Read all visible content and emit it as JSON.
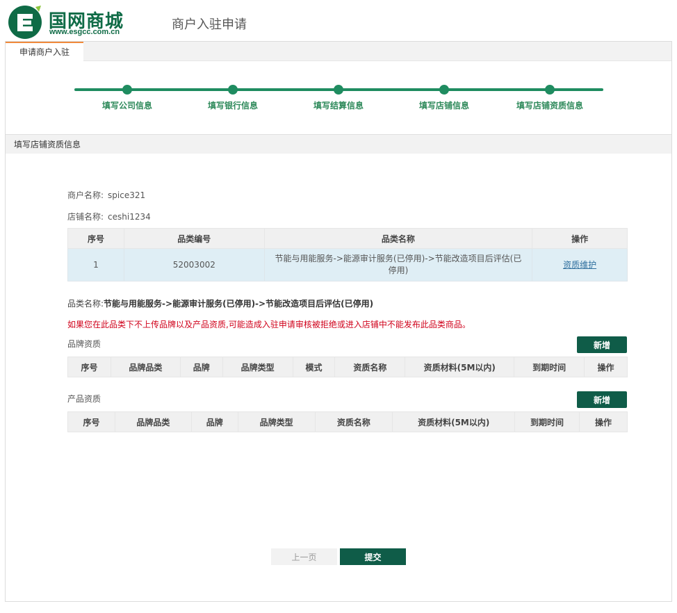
{
  "brand": {
    "name": "国网商城",
    "url": "www.esgcc.com.cn",
    "logo_color": "#0f6b46"
  },
  "header": {
    "title": "商户入驻申请"
  },
  "tabs": {
    "active": "申请商户入驻"
  },
  "steps": [
    {
      "label": "填写公司信息"
    },
    {
      "label": "填写银行信息"
    },
    {
      "label": "填写结算信息"
    },
    {
      "label": "填写店铺信息"
    },
    {
      "label": "填写店铺资质信息"
    }
  ],
  "section": {
    "title": "填写店铺资质信息"
  },
  "merchant": {
    "name_label": "商户名称:",
    "name_value": "spice321",
    "store_label": "店铺名称:",
    "store_value": "ceshi1234"
  },
  "category_table": {
    "headers": [
      "序号",
      "品类编号",
      "品类名称",
      "操作"
    ],
    "rows": [
      {
        "index": "1",
        "code": "52003002",
        "name": "节能与用能服务->能源审计服务(已停用)->节能改造项目后评估(已停用)",
        "action": "资质维护"
      }
    ]
  },
  "category_detail": {
    "label": "品类名称:",
    "value": "节能与用能服务->能源审计服务(已停用)->节能改造项目后评估(已停用)"
  },
  "warning": "如果您在此品类下不上传品牌以及产品资质,可能造成入驻申请审核被拒绝或进入店铺中不能发布此品类商品。",
  "brand_qual": {
    "title": "品牌资质",
    "add_label": "新增",
    "headers": [
      "序号",
      "品牌品类",
      "品牌",
      "品牌类型",
      "模式",
      "资质名称",
      "资质材料(5M以内)",
      "到期时间",
      "操作"
    ]
  },
  "product_qual": {
    "title": "产品资质",
    "add_label": "新增",
    "headers": [
      "序号",
      "品牌品类",
      "品牌",
      "品牌类型",
      "资质名称",
      "资质材料(5M以内)",
      "到期时间",
      "操作"
    ]
  },
  "footer": {
    "prev_label": "上一页",
    "submit_label": "提交"
  },
  "colors": {
    "primary": "#0f5c48",
    "step": "#1f8c60",
    "tab_accent": "#f08a3c",
    "warning": "#d0021b",
    "link": "#2f6f9e"
  }
}
